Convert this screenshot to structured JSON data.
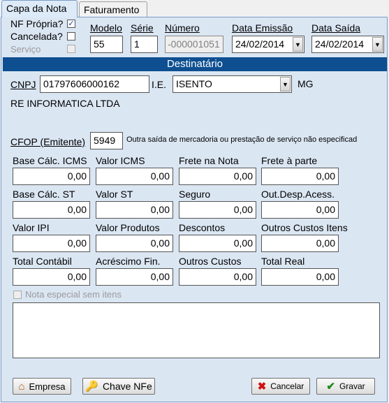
{
  "tabs": [
    {
      "label": "Capa da Nota"
    },
    {
      "label": "Faturamento"
    }
  ],
  "flags": {
    "nf_propria_label": "NF Própria?",
    "nf_propria_checked": "✓",
    "cancelada_label": "Cancelada?",
    "servico_label": "Serviço"
  },
  "header": {
    "modelo_label": "Modelo",
    "modelo_value": "55",
    "serie_label": "Série",
    "serie_value": "1",
    "numero_label": "Número",
    "numero_value": "-000001051",
    "data_emissao_label": "Data Emissão",
    "data_emissao_value": "24/02/2014",
    "data_saida_label": "Data Saída",
    "data_saida_value": "24/02/2014"
  },
  "destinatario": {
    "band_title": "Destinatário",
    "cnpj_label": "CNPJ",
    "cnpj_value": "01797606000162",
    "ie_label": "I.E.",
    "ie_value": "ISENTO",
    "uf": "MG",
    "name": "RE INFORMATICA LTDA"
  },
  "cfop": {
    "label": "CFOP (Emitente)",
    "value": "5949",
    "description": "Outra saída de mercadoria ou prestação de serviço não especificad"
  },
  "totals": {
    "base_icms_label": "Base Cálc. ICMS",
    "base_icms_value": "0,00",
    "valor_icms_label": "Valor ICMS",
    "valor_icms_value": "0,00",
    "frete_nota_label": "Frete na Nota",
    "frete_nota_value": "0,00",
    "frete_parte_label": "Frete à parte",
    "frete_parte_value": "0,00",
    "base_st_label": "Base Cálc. ST",
    "base_st_value": "0,00",
    "valor_st_label": "Valor ST",
    "valor_st_value": "0,00",
    "seguro_label": "Seguro",
    "seguro_value": "0,00",
    "out_desp_label": "Out.Desp.Acess.",
    "out_desp_value": "0,00",
    "valor_ipi_label": "Valor IPI",
    "valor_ipi_value": "0,00",
    "valor_produtos_label": "Valor Produtos",
    "valor_produtos_value": "0,00",
    "descontos_label": "Descontos",
    "descontos_value": "0,00",
    "outros_custos_itens_label": "Outros Custos Itens",
    "outros_custos_itens_value": "0,00",
    "total_contabil_label": "Total Contábil",
    "total_contabil_value": "0,00",
    "acrescimo_fin_label": "Acréscimo Fin.",
    "acrescimo_fin_value": "0,00",
    "outros_custos_label": "Outros Custos",
    "outros_custos_value": "0,00",
    "total_real_label": "Total Real",
    "total_real_value": "0,00"
  },
  "nota_especial_label": "Nota especial sem itens",
  "buttons": {
    "empresa": "Empresa",
    "chave_nfe": "Chave NFe",
    "cancelar": "Cancelar",
    "gravar": "Gravar"
  },
  "colors": {
    "band": "#0d4f91",
    "panel": "#dbe6f3",
    "cancel_icon": "#d01010",
    "ok_icon": "#1a8a1a"
  }
}
